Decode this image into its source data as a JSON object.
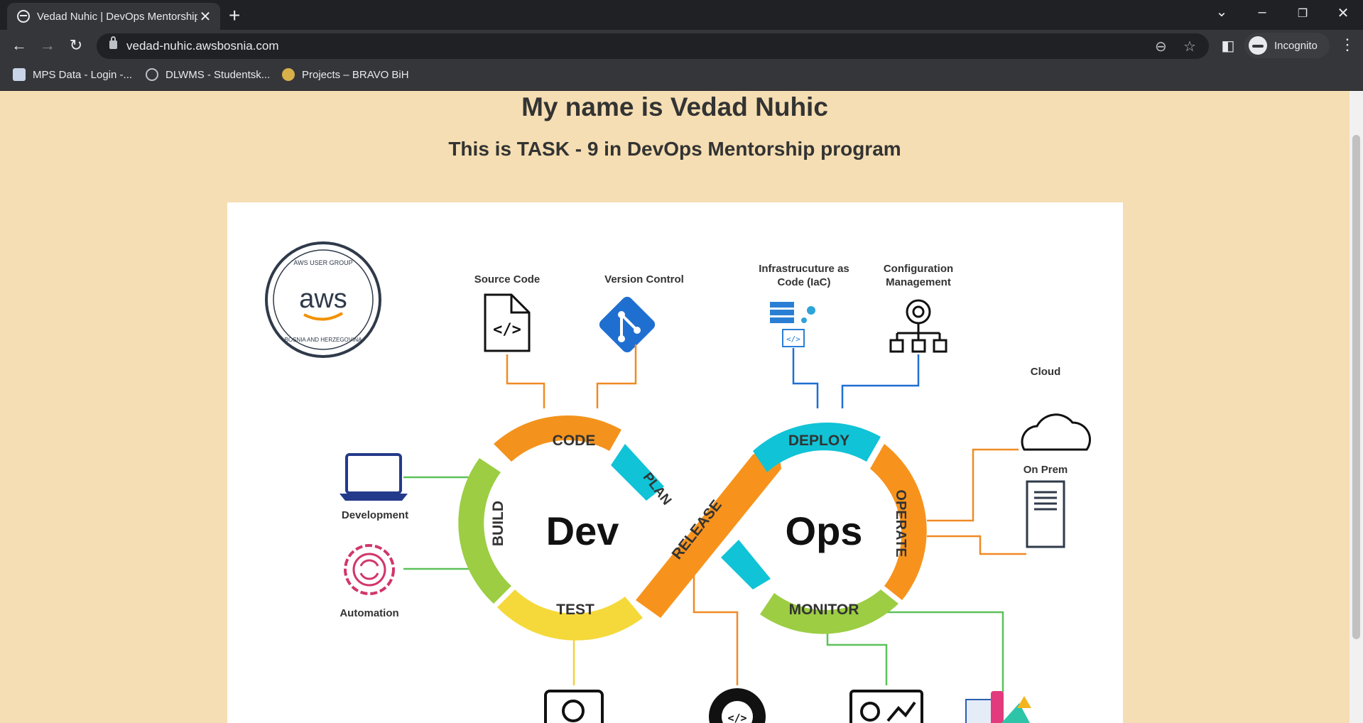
{
  "browser": {
    "tab_title": "Vedad Nuhic | DevOps Mentorship",
    "tab_close": "✕",
    "new_tab": "+",
    "url": "vedad-nuhic.awsbosnia.com",
    "profile_label": "Incognito",
    "bookmarks": [
      {
        "label": "MPS Data - Login -..."
      },
      {
        "label": "DLWMS - Studentsk..."
      },
      {
        "label": "Projects – BRAVO BiH"
      }
    ]
  },
  "page": {
    "heading": "My name is Vedad Nuhic",
    "subheading": "This is TASK - 9 in DevOps Mentorship program"
  },
  "diagram": {
    "logo": {
      "center": "aws",
      "top_text": "AWS USER GROUP",
      "bottom_text": "BOSNIA AND HERZEGOVINA"
    },
    "center_left": "Dev",
    "center_right": "Ops",
    "stages": [
      "CODE",
      "PLAN",
      "BUILD",
      "TEST",
      "RELEASE",
      "DEPLOY",
      "OPERATE",
      "MONITOR"
    ],
    "tools": {
      "source_code": "Source Code",
      "version_control": "Version Control",
      "iac_line1": "Infrastrucuture as",
      "iac_line2": "Code (IaC)",
      "config_line1": "Configuration",
      "config_line2": "Management",
      "cloud": "Cloud",
      "on_prem": "On Prem",
      "development": "Development",
      "automation": "Automation"
    }
  }
}
